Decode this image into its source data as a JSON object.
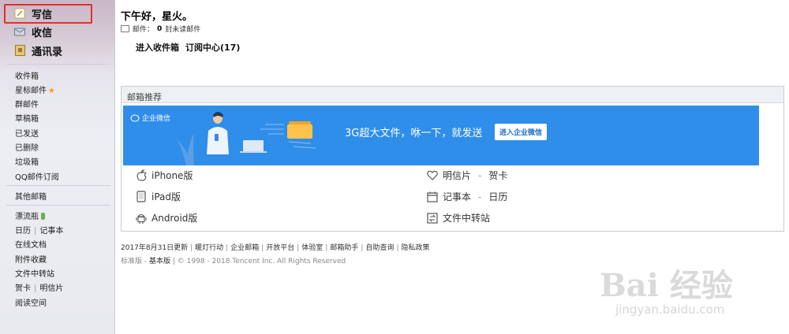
{
  "sidebar": {
    "compose": "写信",
    "inbox": "收信",
    "contacts": "通讯录",
    "folders": [
      "收件箱",
      "星标邮件",
      "群邮件",
      "草稿箱",
      "已发送",
      "已删除",
      "垃圾箱",
      "QQ邮件订阅"
    ],
    "other": "其他邮箱",
    "bottle": "漂流瓶",
    "calendar": "日历",
    "notes": "记事本",
    "docs": "在线文档",
    "attach": "附件收藏",
    "transfer": "文件中转站",
    "card": "贺卡",
    "postcard": "明信片",
    "reading": "阅读空间"
  },
  "main": {
    "greeting": "下午好，星火。",
    "mail_label": "邮件：",
    "unread_count": "0",
    "unread_text": "封未读邮件",
    "enter_inbox": "进入收件箱",
    "subscription": "订阅中心(17)"
  },
  "recommend": {
    "title": "邮箱推荐",
    "brand": "企业微信",
    "slogan": "3G超大文件，咻一下，就发送",
    "cta": "进入企业微信",
    "apps_left": [
      "iPhone版",
      "iPad版",
      "Android版"
    ],
    "apps_right": [
      {
        "main": "明信片",
        "sep": "-",
        "sub": "贺卡"
      },
      {
        "main": "记事本",
        "sep": "-",
        "sub": "日历"
      },
      {
        "main": "文件中转站",
        "sep": "",
        "sub": ""
      }
    ]
  },
  "footer": {
    "links": [
      "2017年8月31日更新",
      "暖灯行动",
      "企业邮箱",
      "开放平台",
      "体验室",
      "邮箱助手",
      "自助查询",
      "隐私政策"
    ],
    "std": "标准版",
    "basic": "基本版",
    "copyright": "© 1998 - 2018 Tencent Inc. All Rights Reserved"
  },
  "watermark": {
    "brand": "Bai 经验",
    "url": "jingyan.baidu.com"
  },
  "colors": {
    "banner": "#2f8eea",
    "highlight": "#e3302a"
  }
}
